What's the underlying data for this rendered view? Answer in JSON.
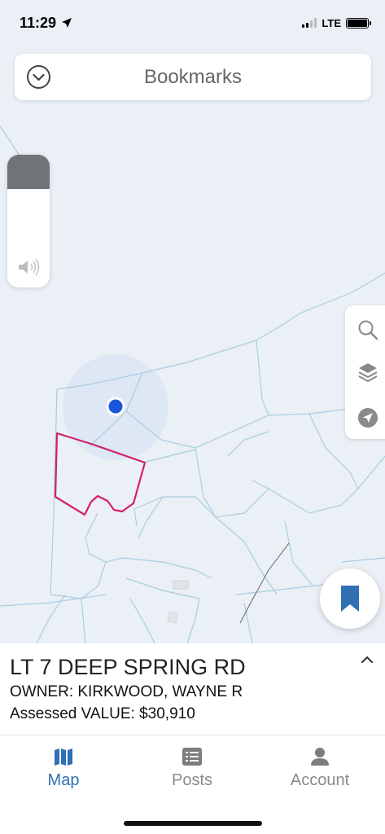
{
  "status_bar": {
    "time": "11:29",
    "network": "LTE"
  },
  "search": {
    "label": "Bookmarks",
    "icon": "chevron-down-circle-icon"
  },
  "map_tools": [
    "search-icon",
    "layers-icon",
    "locate-icon"
  ],
  "parcel": {
    "title": "LT 7 DEEP SPRING RD",
    "owner": "OWNER: KIRKWOOD, WAYNE R",
    "value": "Assessed VALUE: $30,910"
  },
  "tabs": [
    {
      "label": "Map",
      "icon": "map-icon",
      "active": true
    },
    {
      "label": "Posts",
      "icon": "list-icon",
      "active": false
    },
    {
      "label": "Account",
      "icon": "person-icon",
      "active": false
    }
  ],
  "colors": {
    "accent": "#2f6fb3",
    "parcel_outline": "#d61f6b",
    "location_dot": "#1a56db",
    "map_lines": "#a9cde3",
    "map_background": "#eaf0f5"
  }
}
